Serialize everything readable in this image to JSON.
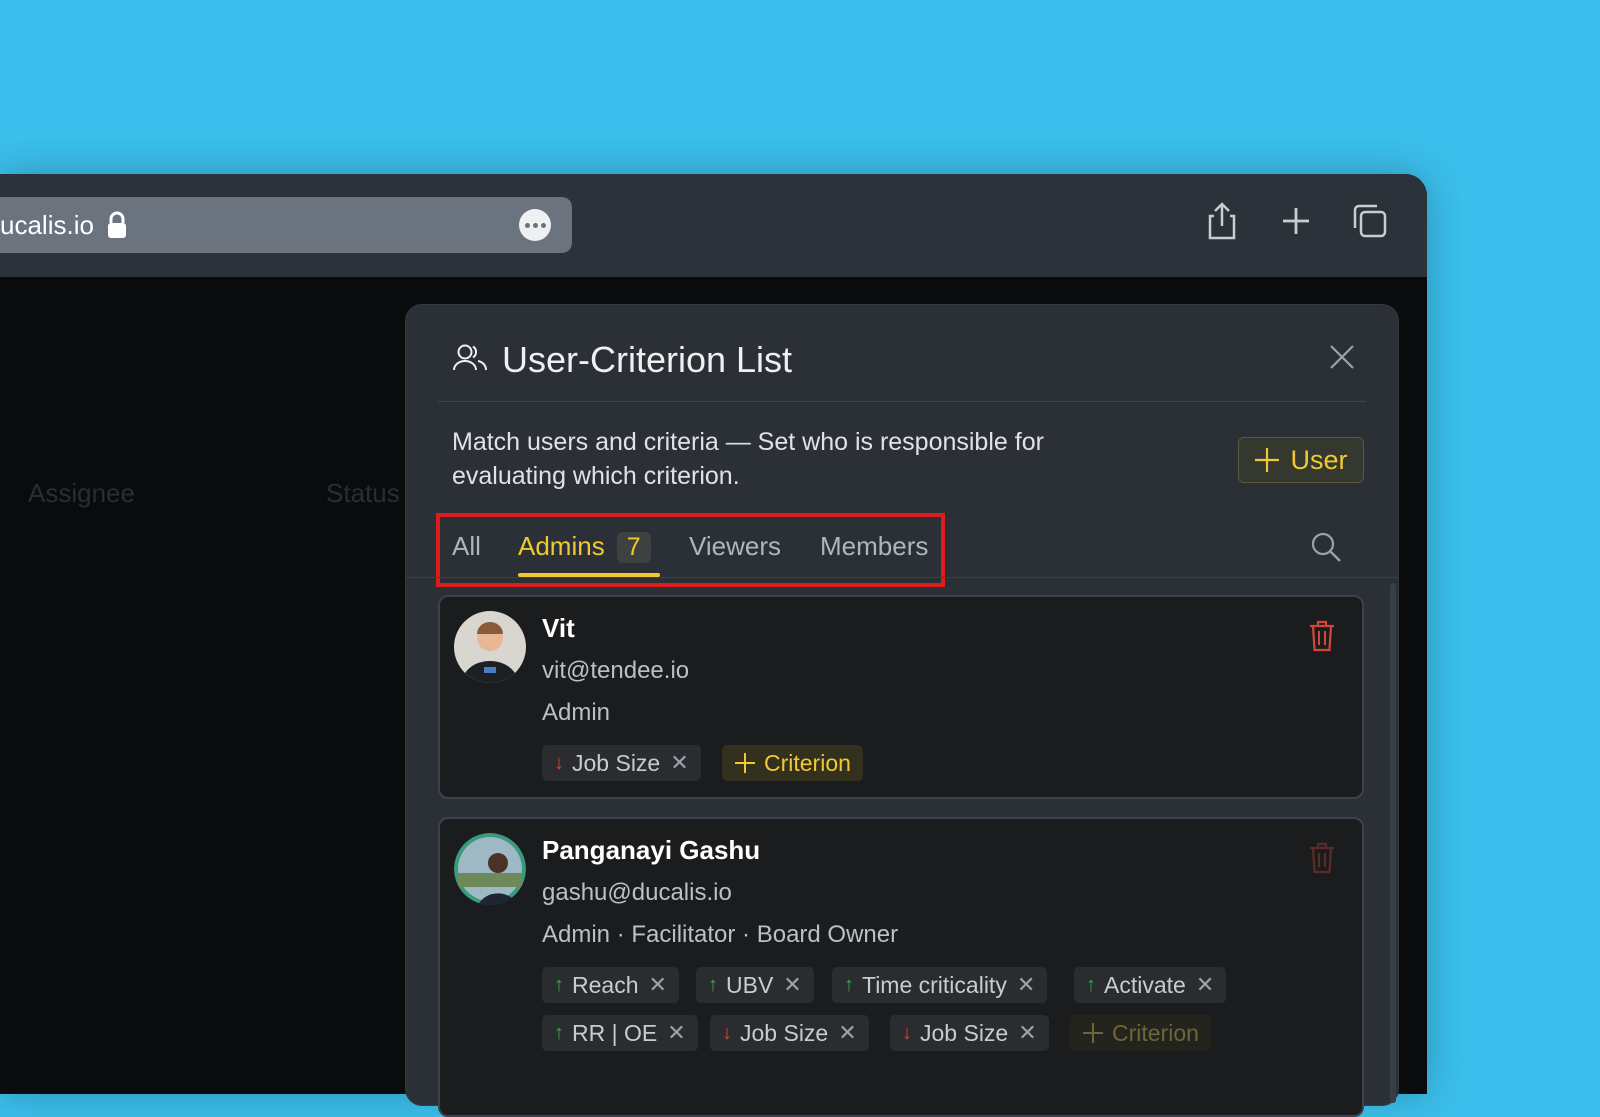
{
  "browser": {
    "url": "ucalis.io",
    "more_label": "•••",
    "icons": [
      "lock-icon",
      "more-icon",
      "share-icon",
      "plus-icon",
      "tabs-icon"
    ]
  },
  "background": {
    "col_assignee": "Assignee",
    "col_status": "Status"
  },
  "modal": {
    "title": "User-Criterion List",
    "description": "Match users and criteria — Set who is responsible for evaluating which criterion.",
    "add_user_label": "User",
    "tabs": [
      {
        "label": "All"
      },
      {
        "label": "Admins",
        "count": "7",
        "active": true
      },
      {
        "label": "Viewers"
      },
      {
        "label": "Members"
      }
    ]
  },
  "users": [
    {
      "name": "Vit",
      "email": "vit@tendee.io",
      "role": "Admin",
      "criteria": [
        {
          "label": "Job Size",
          "dir": "down"
        }
      ],
      "add_label": "Criterion"
    },
    {
      "name": "Panganayi Gashu",
      "email": "gashu@ducalis.io",
      "role": "Admin · Facilitator · Board Owner",
      "criteria": [
        {
          "label": "Reach",
          "dir": "up"
        },
        {
          "label": "UBV",
          "dir": "up"
        },
        {
          "label": "Time criticality",
          "dir": "up"
        },
        {
          "label": "Activate",
          "dir": "up"
        },
        {
          "label": "RR | OE",
          "dir": "up"
        },
        {
          "label": "Job Size",
          "dir": "down"
        },
        {
          "label": "Job Size",
          "dir": "down"
        }
      ],
      "add_label": "Criterion"
    }
  ],
  "colors": {
    "accent": "#f0c932",
    "danger": "#e01b1b",
    "up_arrow": "#38a35a",
    "down_arrow": "#d2473a",
    "page_bg": "#3bbfec"
  }
}
